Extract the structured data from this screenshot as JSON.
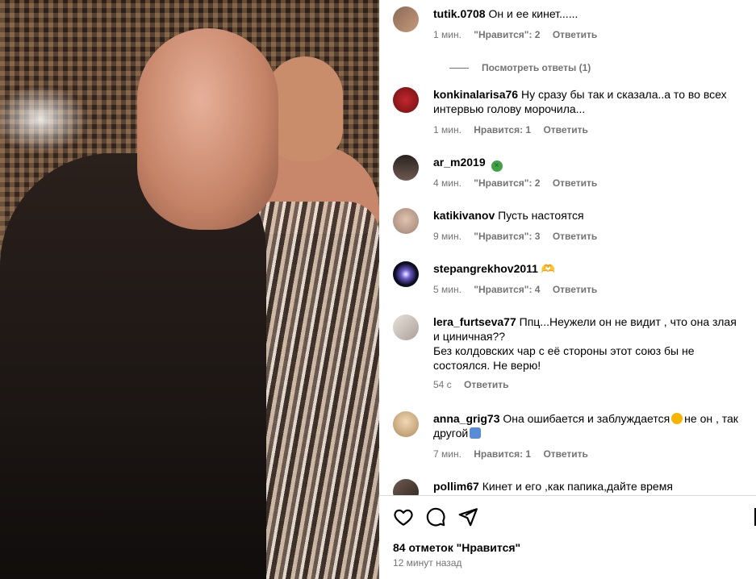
{
  "post": {
    "likes_count_label": "84 отметок \"Нравится\"",
    "time_ago": "12 минут назад"
  },
  "comments": [
    {
      "username": "tutik.0708",
      "text": "Он и ее кинет......",
      "time": "1 мин.",
      "likes": "\"Нравится\": 2",
      "reply": "Ответить",
      "view_replies": "Посмотреть ответы (1)"
    },
    {
      "username": "konkinalarisa76",
      "text": "Ну сразу бы так и сказала..а то во всех интервью голову морочила...",
      "time": "1 мин.",
      "likes": "Нравится: 1",
      "reply": "Ответить"
    },
    {
      "username": "ar_m2019",
      "text": "",
      "emoji": "nauseated-face-icon",
      "time": "4 мин.",
      "likes": "\"Нравится\": 2",
      "reply": "Ответить"
    },
    {
      "username": "katikivanov",
      "text": "Пусть настоятся",
      "time": "9 мин.",
      "likes": "\"Нравится\": 3",
      "reply": "Ответить"
    },
    {
      "username": "stepangrekhov2011",
      "text": "🫶",
      "time": "5 мин.",
      "likes": "\"Нравится\": 4",
      "reply": "Ответить"
    },
    {
      "username": "lera_furtseva77",
      "text": "Ппц...Неужели он не видит , что она злая и циничная??",
      "text2": "Без колдовских чар с её стороны этот союз бы не состоялся. Не верю!",
      "time": "54 с",
      "reply": "Ответить"
    },
    {
      "username": "anna_grig73",
      "text_a": "Она ошибается и заблуждается",
      "text_b": "не он , так другой",
      "time": "7 мин.",
      "likes": "Нравится: 1",
      "reply": "Ответить"
    },
    {
      "username": "pollim67",
      "text": "Кинет и его ,как папика,дайте время"
    }
  ],
  "colors": {
    "muted": "#737373",
    "divider": "#dbdbdb"
  }
}
